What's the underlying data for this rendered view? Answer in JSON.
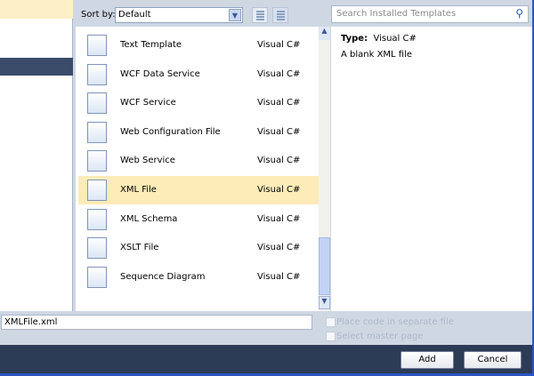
{
  "sort": {
    "label": "Sort by:",
    "value": "Default"
  },
  "search": {
    "placeholder": "Search Installed Templates"
  },
  "templates": [
    {
      "name": "Text Template",
      "language": "Visual C#"
    },
    {
      "name": "WCF Data Service",
      "language": "Visual C#"
    },
    {
      "name": "WCF Service",
      "language": "Visual C#"
    },
    {
      "name": "Web Configuration File",
      "language": "Visual C#"
    },
    {
      "name": "Web Service",
      "language": "Visual C#"
    },
    {
      "name": "XML File",
      "language": "Visual C#"
    },
    {
      "name": "XML Schema",
      "language": "Visual C#"
    },
    {
      "name": "XSLT File",
      "language": "Visual C#"
    },
    {
      "name": "Sequence Diagram",
      "language": "Visual C#"
    }
  ],
  "selected_index": 5,
  "details": {
    "type_label": "Type:",
    "type_value": "Visual C#",
    "description": "A blank XML file"
  },
  "name_field": {
    "value": "XMLFile.xml"
  },
  "options": {
    "separate_code": "Place code in separate file",
    "master_page": "Select master page"
  },
  "buttons": {
    "add": "Add",
    "cancel": "Cancel"
  }
}
